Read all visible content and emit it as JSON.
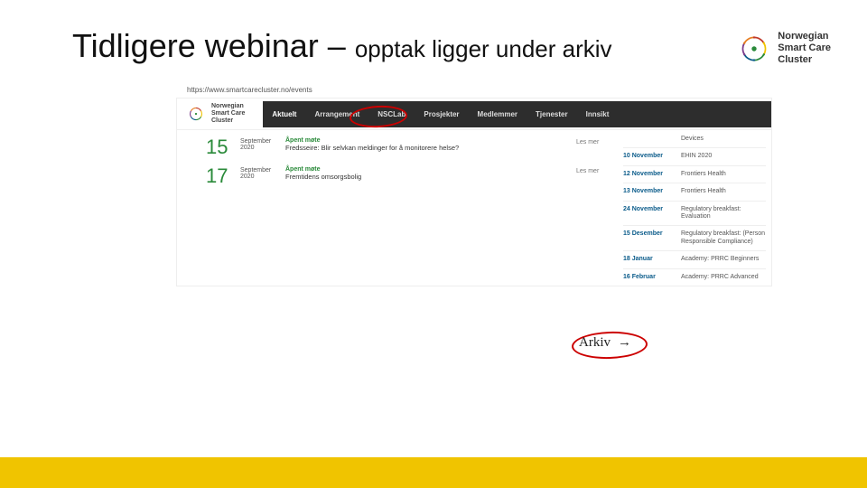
{
  "header": {
    "title_main": "Tidligere webinar – ",
    "title_sub": "opptak ligger under arkiv",
    "brand_line1": "Norwegian",
    "brand_line2": "Smart Care",
    "brand_line3": "Cluster"
  },
  "screenshot": {
    "url": "https://www.smartcarecluster.no/events",
    "mini_brand_line1": "Norwegian",
    "mini_brand_line2": "Smart Care",
    "mini_brand_line3": "Cluster",
    "nav": {
      "items": [
        "Aktuelt",
        "Arrangement",
        "NSCLab",
        "Prosjekter",
        "Medlemmer",
        "Tjenester",
        "Innsikt"
      ]
    },
    "events": [
      {
        "day": "15",
        "month": "September",
        "year": "2020",
        "kind": "Åpent møte",
        "title": "Fredsseire: Blir selvkan meldinger for å monitorere helse?",
        "more": "Les mer"
      },
      {
        "day": "17",
        "month": "September",
        "year": "2020",
        "kind": "Åpent møte",
        "title": "Fremtidens omsorgsbolig",
        "more": "Les mer"
      }
    ],
    "sidebar": [
      {
        "date": "",
        "title": "Devices"
      },
      {
        "date": "10 November",
        "title": "EHIN 2020"
      },
      {
        "date": "12 November",
        "title": "Frontiers Health"
      },
      {
        "date": "13 November",
        "title": "Frontiers Health"
      },
      {
        "date": "24 November",
        "title": "Regulatory breakfast: Evaluation"
      },
      {
        "date": "15 Desember",
        "title": "Regulatory breakfast: (Person Responsible Compliance)"
      },
      {
        "date": "18 Januar",
        "title": "Academy: PRRC Beginners"
      },
      {
        "date": "16 Februar",
        "title": "Academy: PRRC Advanced"
      }
    ],
    "arkiv_label": "Arkiv"
  }
}
